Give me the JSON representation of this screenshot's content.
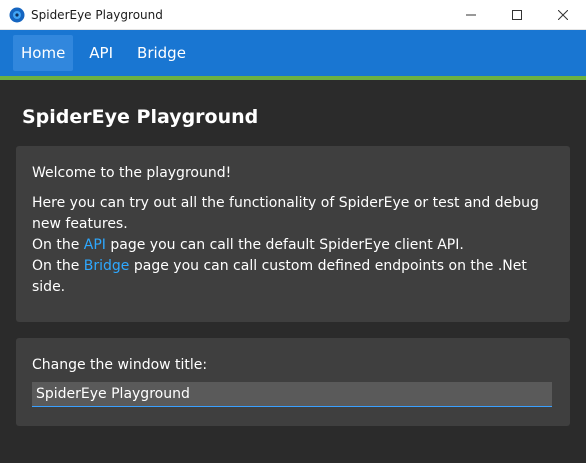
{
  "window": {
    "title": "SpiderEye Playground",
    "icon": "spidereye-logo-icon",
    "controls": [
      "minimize-icon",
      "maximize-icon",
      "close-icon"
    ]
  },
  "nav": {
    "items": [
      {
        "label": "Home",
        "active": true
      },
      {
        "label": "API",
        "active": false
      },
      {
        "label": "Bridge",
        "active": false
      }
    ]
  },
  "colors": {
    "nav_bg": "#1976d2",
    "accent_line": "#6bb043",
    "page_bg": "#2b2b2b",
    "card_bg": "#3f3f3f",
    "link": "#2ea8ff"
  },
  "page": {
    "title": "SpiderEye Playground"
  },
  "welcome": {
    "greeting": "Welcome to the playground!",
    "line1": "Here you can try out all the functionality of SpiderEye or test and debug new features.",
    "line2_prefix": "On the ",
    "line2_link": "API",
    "line2_suffix": " page you can call the default SpiderEye client API.",
    "line3_prefix": "On the ",
    "line3_link": "Bridge",
    "line3_suffix": " page you can call custom defined endpoints on the .Net side."
  },
  "title_form": {
    "label": "Change the window title:",
    "value": "SpiderEye Playground"
  }
}
